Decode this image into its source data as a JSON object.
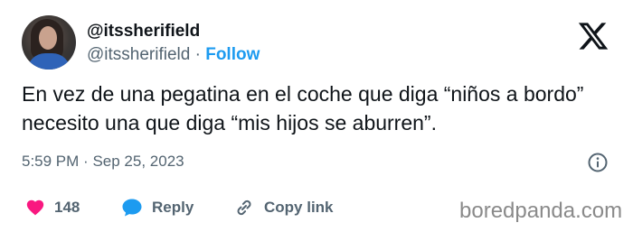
{
  "user": {
    "display_name": "@itssherifield",
    "handle": "@itssherifield",
    "separator": "·",
    "follow_label": "Follow"
  },
  "tweet": {
    "text": "En vez de una pegatina en el coche que diga “niños a bordo” necesito una que diga “mis hijos se aburren”.",
    "time": "5:59 PM",
    "date_separator": "·",
    "date": "Sep 25, 2023"
  },
  "actions": {
    "like_count": "148",
    "reply_label": "Reply",
    "copy_label": "Copy link"
  },
  "watermark": "boredpanda.com",
  "colors": {
    "accent": "#1d9bf0",
    "like": "#f91880",
    "text": "#0f1419",
    "muted": "#536471"
  },
  "icons": [
    "x-logo-icon",
    "info-icon",
    "heart-icon",
    "reply-bubble-icon",
    "link-icon"
  ]
}
